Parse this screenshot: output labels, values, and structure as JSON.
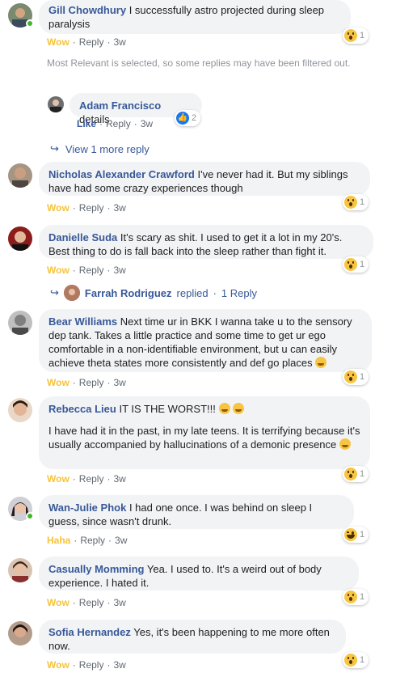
{
  "comments": [
    {
      "author": "Gill Chowdhury",
      "text": "I successfully astro projected during sleep paralysis",
      "reaction": "Wow",
      "reply": "Reply",
      "time": "3w",
      "count": "1"
    },
    {
      "author": "Nicholas Alexander Crawford",
      "text": "I've never had it. But my siblings have had some crazy experiences though",
      "reaction": "Wow",
      "reply": "Reply",
      "time": "3w",
      "count": "1"
    },
    {
      "author": "Danielle Suda",
      "text": "It's scary as shit. I used to get it a lot in my 20's. Best thing to do is fall back into the sleep rather than fight it.",
      "reaction": "Wow",
      "reply": "Reply",
      "time": "3w",
      "count": "1"
    },
    {
      "author": "Bear Williams",
      "text": "Next time ur in BKK I wanna take u to the sensory dep tank. Takes a little practice and some time to get ur ego comfortable in a non-identifiable environment, but u can easily achieve theta states more consistently and def go places",
      "reaction": "Wow",
      "reply": "Reply",
      "time": "3w",
      "count": "1"
    },
    {
      "author": "Rebecca Lieu",
      "text": "IT IS THE WORST!!!",
      "text2": "I have had it in the past, in my late teens. It is terrifying because it's usually accompanied by hallucinations of a demonic presence",
      "reaction": "Wow",
      "reply": "Reply",
      "time": "3w",
      "count": "1"
    },
    {
      "author": "Wan-Julie Phok",
      "text": "I had one once. I was behind on sleep I guess, since wasn't drunk.",
      "reaction": "Haha",
      "reply": "Reply",
      "time": "3w",
      "count": "1"
    },
    {
      "author": "Casually Momming",
      "text": "Yea. I used to. It's a weird out of body experience. I hated it.",
      "reaction": "Wow",
      "reply": "Reply",
      "time": "3w",
      "count": "1"
    },
    {
      "author": "Sofia Hernandez",
      "text": "Yes, it's been happening to me more often now.",
      "reaction": "Wow",
      "reply": "Reply",
      "time": "3w",
      "count": "1"
    }
  ],
  "notice": "Most Relevant is selected, so some replies may have been filtered out.",
  "nested_reply": {
    "author": "Adam Francisco",
    "text": "details",
    "reaction": "Like",
    "reply": "Reply",
    "time": "3w",
    "count": "2"
  },
  "view_more": "View 1 more reply",
  "farrah": {
    "name": "Farrah Rodriguez",
    "replied": "replied",
    "sep": "·",
    "count": "1 Reply"
  },
  "dot": "·",
  "colors": {
    "author": "#385898",
    "bubble": "#f2f3f5",
    "wow": "#f5c33b",
    "online": "#42b72a"
  }
}
